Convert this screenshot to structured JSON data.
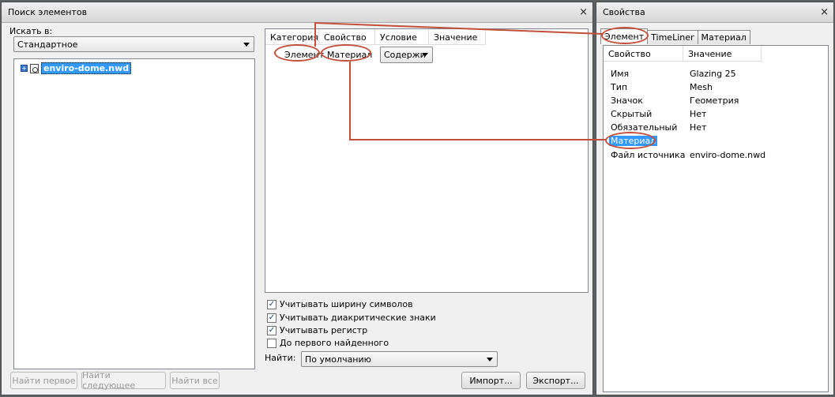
{
  "search_panel": {
    "title": "Поиск элементов",
    "close": "×",
    "search_in_label": "Искать в:",
    "search_in_value": "Стандартное",
    "tree": {
      "expander": "+",
      "item": "enviro-dome.nwd"
    },
    "grid": {
      "columns": [
        "Категория",
        "Свойство",
        "Условие",
        "Значение"
      ],
      "row": {
        "category": "Элемент",
        "property": "Материал",
        "condition": "Содержи",
        "value": ""
      }
    },
    "options": [
      {
        "label": "Учитывать ширину символов",
        "checked": true
      },
      {
        "label": "Учитывать диакритические знаки",
        "checked": true
      },
      {
        "label": "Учитывать регистр",
        "checked": true
      },
      {
        "label": "До первого найденного",
        "checked": false
      }
    ],
    "find_label": "Найти:",
    "find_value": "По умолчанию",
    "buttons": {
      "find_first": "Найти первое",
      "find_next": "Найти следующее",
      "find_all": "Найти все",
      "import": "Импорт...",
      "export": "Экспорт..."
    }
  },
  "properties_panel": {
    "title": "Свойства",
    "close": "×",
    "tabs": [
      "Элемент",
      "TimeLiner",
      "Материал"
    ],
    "active_tab": "Элемент",
    "columns": {
      "property": "Свойство",
      "value": "Значение"
    },
    "rows": [
      {
        "key": "Имя",
        "value": "Glazing 25"
      },
      {
        "key": "Тип",
        "value": "Mesh"
      },
      {
        "key": "Значок",
        "value": "Геометрия"
      },
      {
        "key": "Скрытый",
        "value": "Нет"
      },
      {
        "key": "Обязательный",
        "value": "Нет"
      },
      {
        "key": "Материал",
        "value": ""
      },
      {
        "key": "Файл источника",
        "value": "enviro-dome.nwd"
      }
    ]
  },
  "colors": {
    "annotation": "#c0503a",
    "selection": "#3399ff"
  }
}
